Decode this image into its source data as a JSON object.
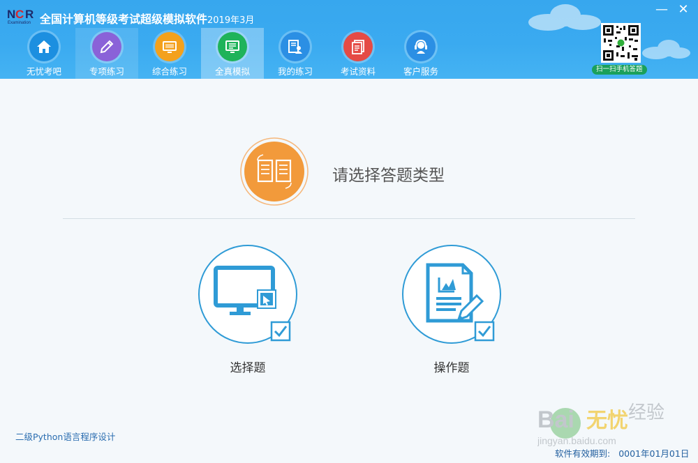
{
  "app": {
    "logo_text": "NCR",
    "logo_sub": "Examination",
    "title": "全国计算机等级考试超级模拟软件",
    "version_date": "2019年3月",
    "minimize": "—",
    "close": "✕"
  },
  "nav": [
    {
      "label": "无忧考吧",
      "icon": "home-icon",
      "color": "#1c8fe0"
    },
    {
      "label": "专项练习",
      "icon": "pencil-icon",
      "color": "#8a62d8"
    },
    {
      "label": "综合练习",
      "icon": "monitor-icon",
      "color": "#f4a11c"
    },
    {
      "label": "全真模拟",
      "icon": "exam-screen-icon",
      "color": "#1fb35a"
    },
    {
      "label": "我的练习",
      "icon": "user-doc-icon",
      "color": "#2b8fe4"
    },
    {
      "label": "考试资料",
      "icon": "documents-icon",
      "color": "#e54b45"
    },
    {
      "label": "客户服务",
      "icon": "headset-icon",
      "color": "#2b8fe4"
    }
  ],
  "qr": {
    "label": "扫一扫手机答题"
  },
  "main": {
    "prompt": "请选择答题类型",
    "options": [
      {
        "label": "选择题",
        "icon": "monitor-select-icon"
      },
      {
        "label": "操作题",
        "icon": "document-edit-icon"
      }
    ]
  },
  "footer": {
    "subject": "二级Python语言程序设计",
    "expiry_label": "软件有效期到:",
    "expiry_date": "0001年01月01日"
  },
  "colors": {
    "header": "#3aaaf0",
    "accent_blue": "#2f9bd6",
    "orange": "#f29a3b"
  }
}
